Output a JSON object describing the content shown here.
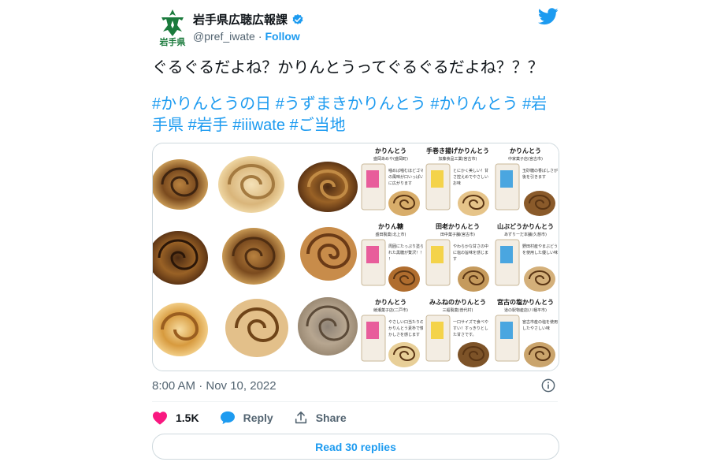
{
  "account": {
    "name": "岩手県広聴広報課",
    "handle": "@pref_iwate",
    "separator": "·",
    "follow_label": "Follow",
    "logo_text": "岩手県"
  },
  "tweet": {
    "text": "ぐるぐるだよね？かりんとうってぐるぐるだよね？？？",
    "hashtags_line1": [
      "#かりんとうの日",
      "#うずまきかりんとう",
      "#かりんとう",
      "#岩"
    ],
    "hashtags_line2": [
      "手県",
      "#岩手",
      "#iiiwate",
      "#ご当地"
    ],
    "timestamp": "8:00 AM · Nov 10, 2022"
  },
  "media": {
    "products": [
      {
        "name": "かりんとう",
        "maker": "盛岡あめや(盛岡町)",
        "note": "噛めば噛むほどゴマの風味が口いっぱいに広がります"
      },
      {
        "name": "手巻き揚げかりんとう",
        "maker": "加藤食品工業(宮古市)",
        "note": "とにかく美しい！甘さ控えめでやさしいお味"
      },
      {
        "name": "かりんとう",
        "maker": "中家菓子店(宮古市)",
        "note": "玉砂糖の香ばしさが後を引きます"
      },
      {
        "name": "かりん糖",
        "maker": "盛田製菓(北上市)",
        "note": "周囲にたっぷり塗られた黒糖が贅沢！！！"
      },
      {
        "name": "田老かりんとう",
        "maker": "田中菓子舗(宮古市)",
        "note": "やわらかな甘さの中に塩の旨味を感じます"
      },
      {
        "name": "山ぶどうかりんとう",
        "maker": "あずりーだ本舗(久慈市)",
        "note": "野田村産やまぶどうを使用した優しい味"
      },
      {
        "name": "かりんとう",
        "maker": "綾瀬菓子店(二戸市)",
        "note": "やさしい口当たりのかりんとう素朴で懐かしさを感じます"
      },
      {
        "name": "みふねのかりんとう",
        "maker": "三船製菓(普代村)",
        "note": "一口サイズで食べやすい！すっきりとした甘さです。"
      },
      {
        "name": "宮古の塩かりんとう",
        "maker": "道の駅物産店(八幡平市)",
        "note": "宮古市産の塩を使用したやさしい味"
      }
    ]
  },
  "engagement": {
    "likes": "1.5K",
    "reply_label": "Reply",
    "share_label": "Share",
    "read_replies_label": "Read 30 replies"
  },
  "colors": {
    "accent": "#1d9bf0",
    "heart": "#f91880",
    "logo_green": "#1a7a3c",
    "text": "#0f1419",
    "muted": "#536471"
  }
}
